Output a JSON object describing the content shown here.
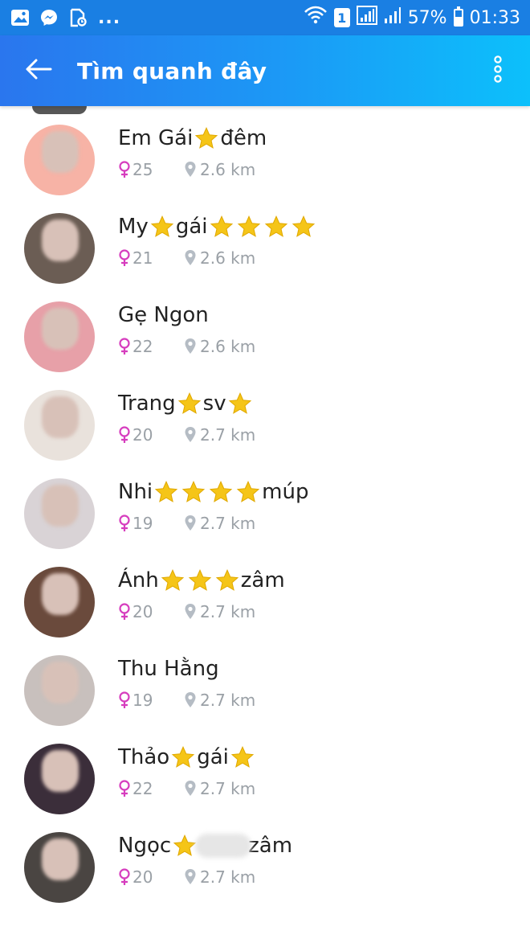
{
  "status_bar": {
    "icons": [
      "gallery-icon",
      "messenger-icon",
      "note-icon"
    ],
    "more": "...",
    "sim_number": "1",
    "battery_percent": "57%",
    "battery_level": 0.57,
    "time": "01:33"
  },
  "app_bar": {
    "title": "Tìm quanh đây",
    "back_icon": "arrow-left-icon",
    "menu_icon": "more-vertical-icon"
  },
  "colors": {
    "star": "#f5c518",
    "female": "#d63dbe",
    "meta": "#9aa0a6",
    "header_start": "#2a76ee",
    "header_end": "#0cc0fb"
  },
  "people": [
    {
      "name_parts": [
        "Em Gái",
        "★",
        "đêm"
      ],
      "age": "25",
      "distance": "2.6 km",
      "avatar_bg": "#f7b3a6"
    },
    {
      "name_parts": [
        "My",
        "★",
        "gái",
        "★",
        "★",
        "★",
        "★"
      ],
      "age": "21",
      "distance": "2.6 km",
      "avatar_bg": "#6b5d54"
    },
    {
      "name_parts": [
        "Gẹ Ngon"
      ],
      "age": "22",
      "distance": "2.6 km",
      "avatar_bg": "#e7a0a8"
    },
    {
      "name_parts": [
        "Trang",
        "★",
        "sv",
        "★"
      ],
      "age": "20",
      "distance": "2.7 km",
      "avatar_bg": "#e9e2dc"
    },
    {
      "name_parts": [
        "Nhi",
        "★",
        "★",
        "★",
        "★",
        "múp"
      ],
      "age": "19",
      "distance": "2.7 km",
      "avatar_bg": "#d9d3d6"
    },
    {
      "name_parts": [
        "Ánh",
        "★",
        "★",
        "★",
        "zâm"
      ],
      "age": "20",
      "distance": "2.7 km",
      "avatar_bg": "#6a4a3c"
    },
    {
      "name_parts": [
        "Thu Hằng"
      ],
      "age": "19",
      "distance": "2.7 km",
      "avatar_bg": "#c8c0bd"
    },
    {
      "name_parts": [
        "Thảo",
        "★",
        "gái",
        "★"
      ],
      "age": "22",
      "distance": "2.7 km",
      "avatar_bg": "#3b2e3a"
    },
    {
      "name_parts": [
        "Ngọc",
        "★",
        "",
        "zâm"
      ],
      "age": "20",
      "distance": "2.7 km",
      "avatar_bg": "#4a4542"
    }
  ]
}
